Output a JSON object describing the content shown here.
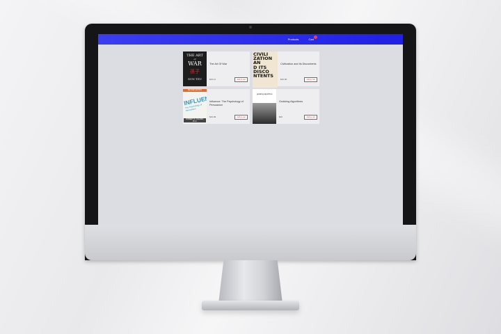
{
  "navbar": {
    "links": [
      {
        "label": "Products"
      },
      {
        "label": "Cart"
      }
    ],
    "cart_badge": ""
  },
  "products": [
    {
      "title": "The Art Of War",
      "price": "$19.11",
      "button": "Add to cart",
      "cover": {
        "lines": [
          "THE ART",
          "of",
          "WAR",
          "孫子",
          "SUN TZU"
        ]
      }
    },
    {
      "title": "Civilization and Its Discontents",
      "price": "$16.00",
      "button": "Add to cart",
      "cover": {
        "lines": [
          "CIVILI",
          "ZATION AN",
          "D ITS",
          "DISCO",
          "NTENTS"
        ]
      }
    },
    {
      "title": "Influence: The Psychology of Persuasion",
      "price": "$19.99",
      "button": "Add to cart",
      "cover": {
        "band": "REVISED EDITION",
        "headline": "INFLUENCE",
        "subtitle": "The Psychology of Persuasion",
        "author": "ROBERT B. CIALDINI, Ph.D."
      }
    },
    {
      "title": "Grokking Algorithms",
      "price": "$40",
      "button": "Add to cart",
      "cover": {
        "headline": "grokking algorithms"
      }
    }
  ]
}
